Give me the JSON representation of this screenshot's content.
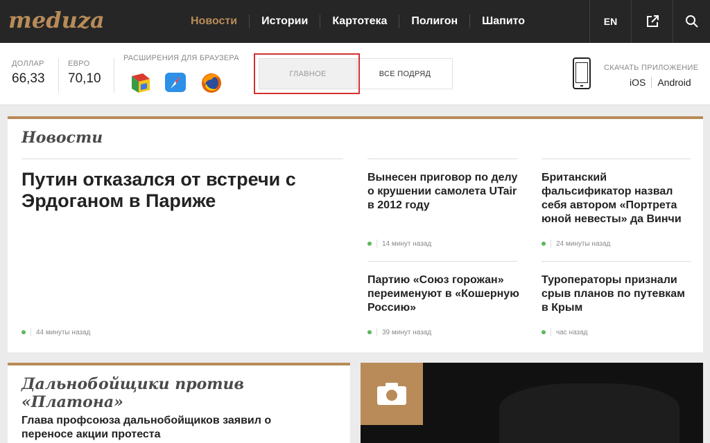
{
  "header": {
    "logo": "meduza",
    "nav": [
      "Новости",
      "Истории",
      "Картотека",
      "Полигон",
      "Шапито"
    ],
    "lang": "EN",
    "share_icon": "external-link-icon",
    "search_icon": "search-icon"
  },
  "currency": {
    "usd_label": "ДОЛЛАР",
    "usd_value": "66,33",
    "eur_label": "ЕВРО",
    "eur_value": "70,10"
  },
  "extensions": {
    "label": "РАСШИРЕНИЯ ДЛЯ БРАУЗЕРА",
    "icons": [
      "chrome-icon",
      "safari-icon",
      "firefox-icon"
    ]
  },
  "tabs": {
    "main": "ГЛАВНОЕ",
    "all": "ВСЕ ПОДРЯД"
  },
  "app": {
    "label": "СКАЧАТЬ ПРИЛОЖЕНИЕ",
    "ios": "iOS",
    "android": "Android"
  },
  "news": {
    "title": "Новости",
    "lead": {
      "title": "Путин отказался от встречи с Эрдоганом в Париже",
      "time": "44 минуты назад"
    },
    "items": [
      {
        "title": "Вынесен приговор по делу о крушении самолета UTair в 2012 году",
        "time": "14 минут назад"
      },
      {
        "title": "Британский фальсификатор назвал себя автором «Портрета юной невесты» да Винчи",
        "time": "24 минуты назад"
      },
      {
        "title": "Партию «Союз горожан» переименуют в «Кошерную Россию»",
        "time": "39 минут назад"
      },
      {
        "title": "Туроператоры признали срыв планов по путевкам в Крым",
        "time": "час назад"
      }
    ]
  },
  "feature": {
    "title": "Дальнобойщики против «Платона»",
    "item": "Глава профсоюза дальнобойщиков заявил о переносе акции протеста"
  },
  "colors": {
    "accent": "#b88b58",
    "topbar": "#262626",
    "status_dot": "#5cb85c",
    "highlight": "#d32f2f"
  }
}
